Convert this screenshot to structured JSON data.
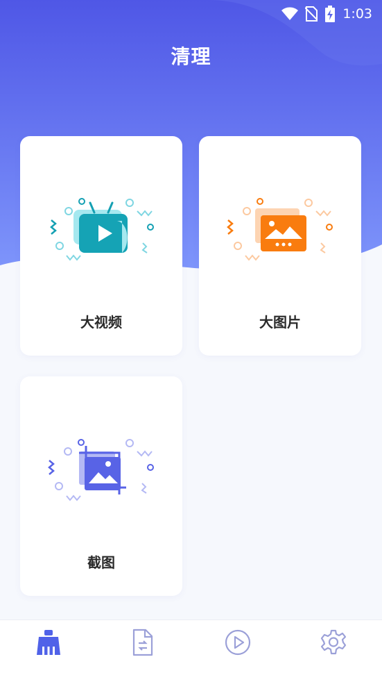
{
  "status_bar": {
    "time": "1:03",
    "icons": [
      "wifi-icon",
      "no-sim-icon",
      "battery-charging-icon"
    ]
  },
  "header": {
    "title": "清理"
  },
  "cards": [
    {
      "label": "大视频",
      "icon": "tv-video-icon",
      "accent": "#15a3b5"
    },
    {
      "label": "大图片",
      "icon": "picture-icon",
      "accent": "#f97c0f"
    },
    {
      "label": "截图",
      "icon": "screenshot-crop-icon",
      "accent": "#5863e6"
    }
  ],
  "bottom_nav": {
    "items": [
      {
        "icon": "broom-clean-icon",
        "active": true
      },
      {
        "icon": "file-transfer-icon",
        "active": false
      },
      {
        "icon": "play-circle-icon",
        "active": false
      },
      {
        "icon": "gear-icon",
        "active": false
      }
    ]
  },
  "colors": {
    "primary": "#4f5ee8",
    "nav_active": "#5062e8",
    "nav_inactive": "#9ba0d8",
    "background": "#f6f8fd"
  }
}
